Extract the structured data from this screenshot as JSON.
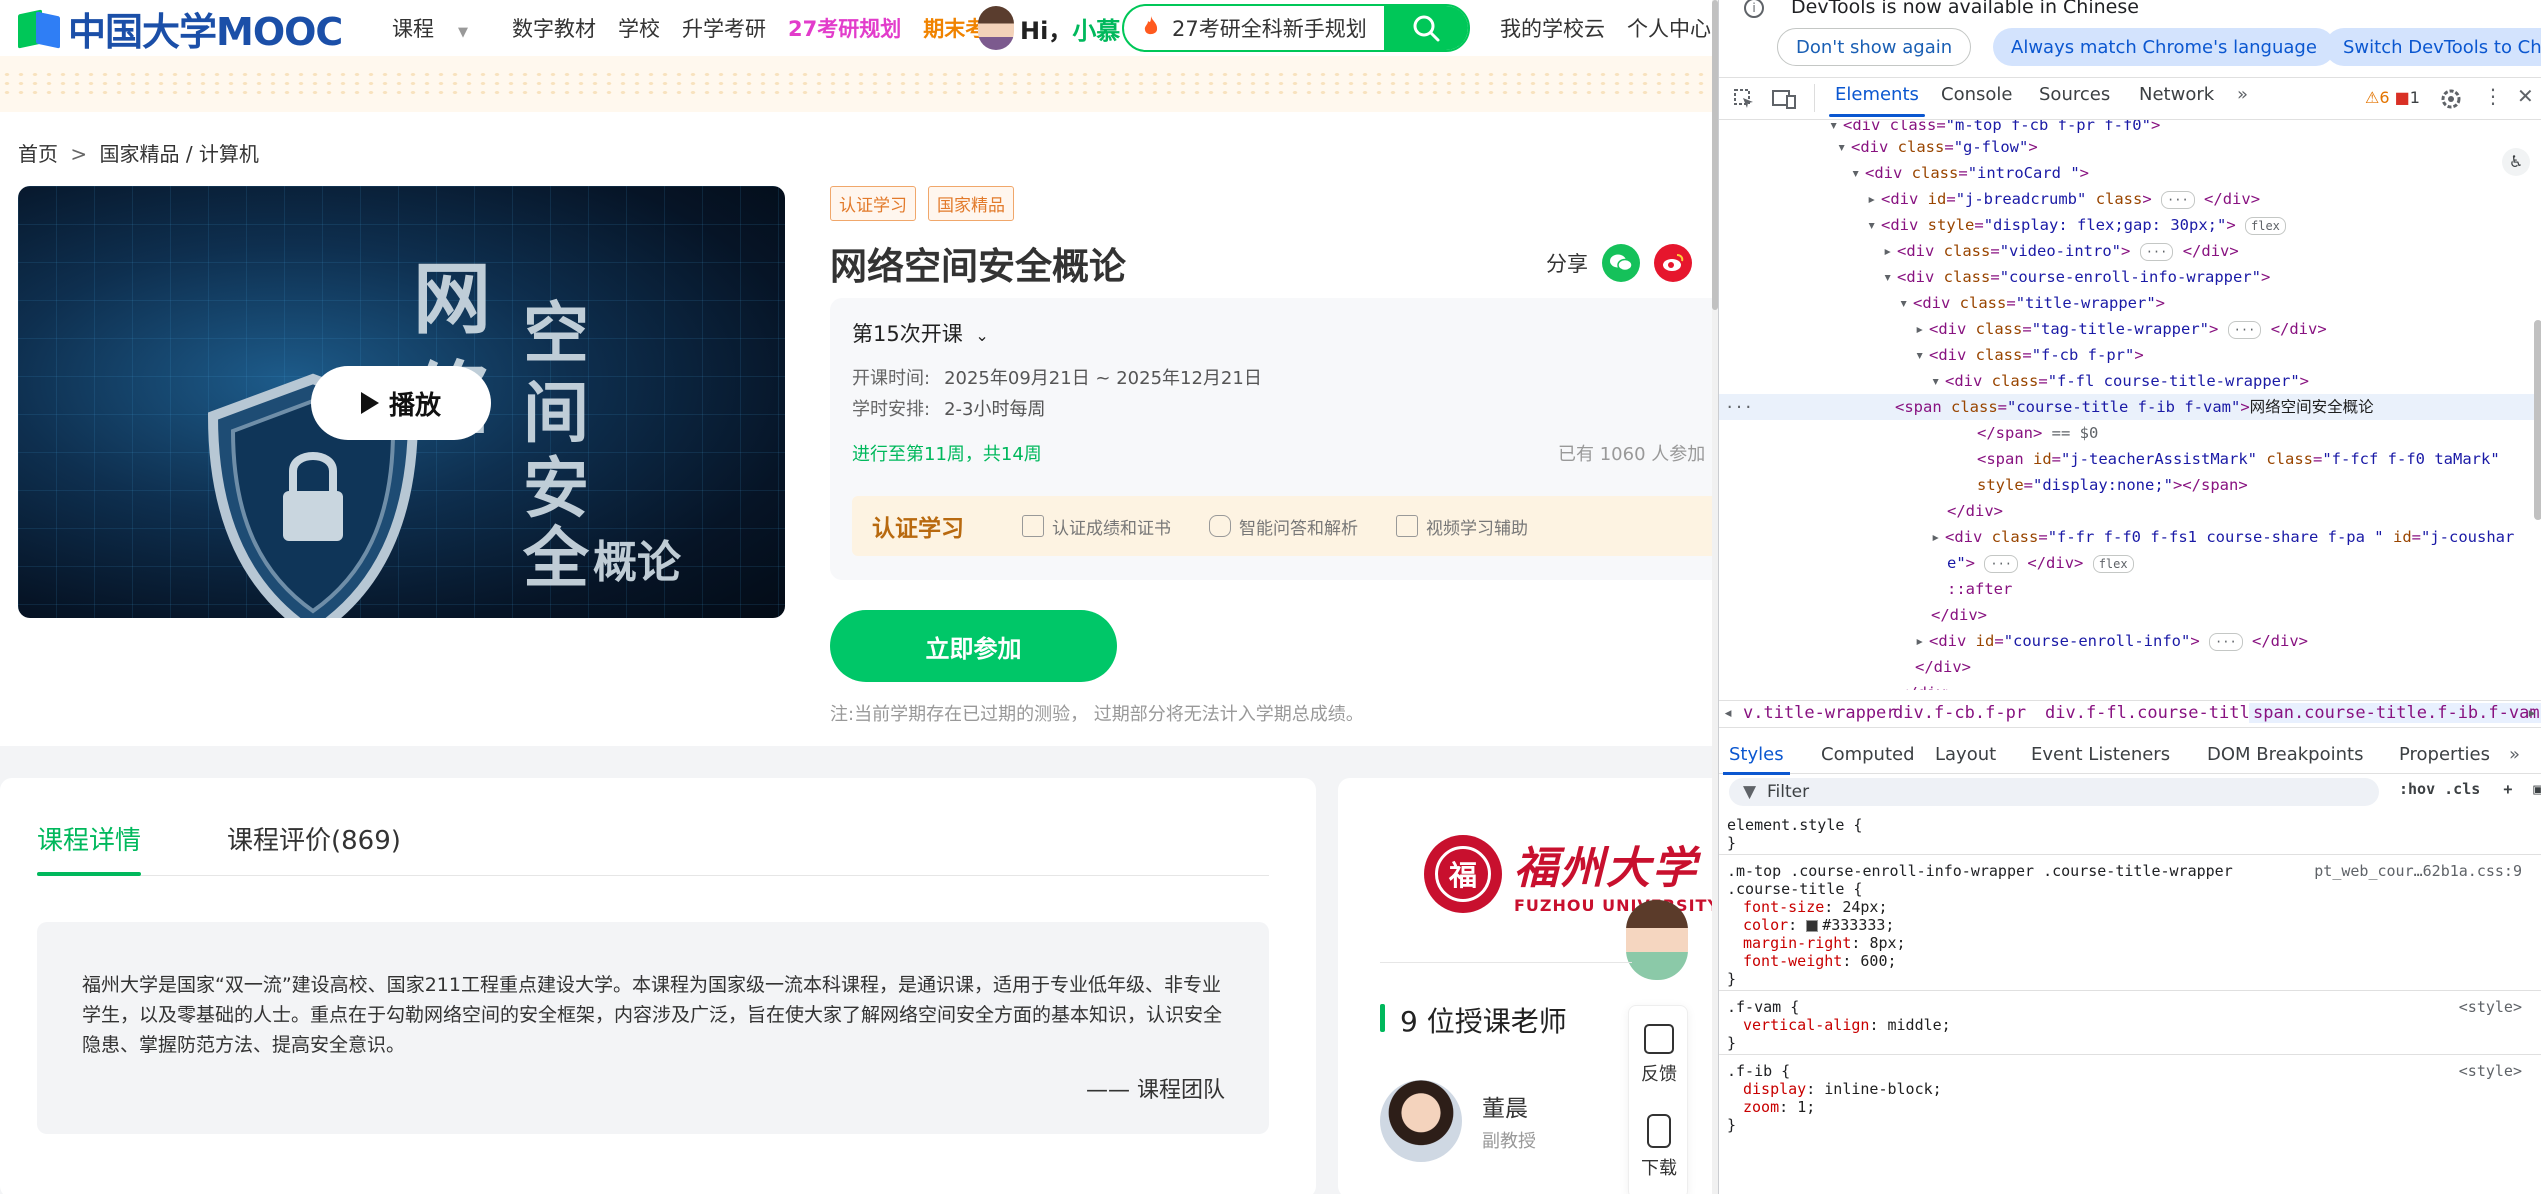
{
  "nav": {
    "logo_text": "中国大学MOOC",
    "links": [
      "课程",
      "数字教材",
      "学校",
      "升学考研",
      "27考研规划",
      "期末考试"
    ],
    "hi_label": "Hi，",
    "hi_name": "小慕",
    "search_text": "27考研全科新手规划",
    "right_links": [
      "我的学校云",
      "个人中心"
    ]
  },
  "breadcrumb": {
    "home": "首页",
    "sep": ">",
    "path": "国家精品 / 计算机"
  },
  "video": {
    "play_label": "播放",
    "title_chars": [
      "网",
      "络",
      "空",
      "间",
      "安",
      "全",
      "概论"
    ]
  },
  "course": {
    "tags": [
      "认证学习",
      "国家精品"
    ],
    "title": "网络空间安全概论",
    "share_label": "分享",
    "term": "第15次开课",
    "start_key": "开课时间:",
    "start_val": "2025年09月21日 ~ 2025年12月21日",
    "hours_key": "学时安排:",
    "hours_val": "2-3小时每周",
    "progress": "进行至第11周，共14周",
    "enrolled": "已有 1060 人参加",
    "cert_title": "认证学习",
    "cert_features": [
      "认证成绩和证书",
      "智能问答和解析",
      "视频学习辅助"
    ],
    "join_label": "立即参加",
    "note": "注:当前学期存在已过期的测验， 过期部分将无法计入学期总成绩。"
  },
  "details": {
    "tabs": [
      "课程详情",
      "课程评价(869)"
    ],
    "description": "福州大学是国家“双一流”建设高校、国家211工程重点建设大学。本课程为国家级一流本科课程，是通识课，适用于专业低年级、非专业学生，以及零基础的人士。重点在于勾勒网络空间的安全框架，内容涉及广泛，旨在使大家了解网络空间安全方面的基本知识，认识安全隐患、掌握防范方法、提高安全意识。",
    "signature": "—— 课程团队"
  },
  "side": {
    "uni_cn": "福州大学",
    "uni_en": "FUZHOU UNIVERSITY",
    "seal_char": "福",
    "teacher_count": "9 位授课老师",
    "teacher_name": "董晨",
    "teacher_title": "副教授",
    "float_feedback": "反馈",
    "float_download": "下载"
  },
  "devtools": {
    "info_text": "DevTools is now available in Chinese",
    "btn_dont_show": "Don't show again",
    "btn_always": "Always match Chrome's language",
    "btn_switch": "Switch DevTools to Chi",
    "tabs": [
      "Elements",
      "Console",
      "Sources",
      "Network"
    ],
    "warn_count": "6",
    "err_count": "1",
    "crumbs": [
      "v.title-wrapper",
      "div.f-cb.f-pr",
      "div.f-fl.course-title-wrapper",
      "span.course-title.f-ib.f-vam"
    ],
    "subtabs": [
      "Styles",
      "Computed",
      "Layout",
      "Event Listeners",
      "DOM Breakpoints",
      "Properties"
    ],
    "filter_placeholder": "Filter",
    "filter_tools": ":hov .cls",
    "rule1_selector": "element.style {",
    "rule2_selector_a": ".m-top .course-enroll-info-wrapper .course-title-wrapper",
    "rule2_selector_b": ".course-title {",
    "rule2_src": "pt_web_cour…62b1a.css:9",
    "rule2_props": [
      {
        "p": "font-size",
        "v": "24px;"
      },
      {
        "p": "color",
        "v": "#333333;"
      },
      {
        "p": "margin-right",
        "v": "8px;"
      },
      {
        "p": "font-weight",
        "v": "600;"
      }
    ],
    "rule3_selector": ".f-vam {",
    "rule3_props": [
      {
        "p": "vertical-align",
        "v": "middle;"
      }
    ],
    "rule4_selector": ".f-ib {",
    "rule4_props": [
      {
        "p": "display",
        "v": "inline-block;"
      },
      {
        "p": "zoom",
        "v": "1;"
      }
    ],
    "style_src": "<style>",
    "close_brace": "}",
    "flex_badge": "flex",
    "after_pseudo": "::after",
    "eq_dollar": "== $0"
  },
  "colors": {
    "brand_green": "#00c758",
    "brand_blue": "#1b4fa8",
    "devtools_blue": "#0b57d0",
    "tag_orange": "#e27a2b"
  }
}
